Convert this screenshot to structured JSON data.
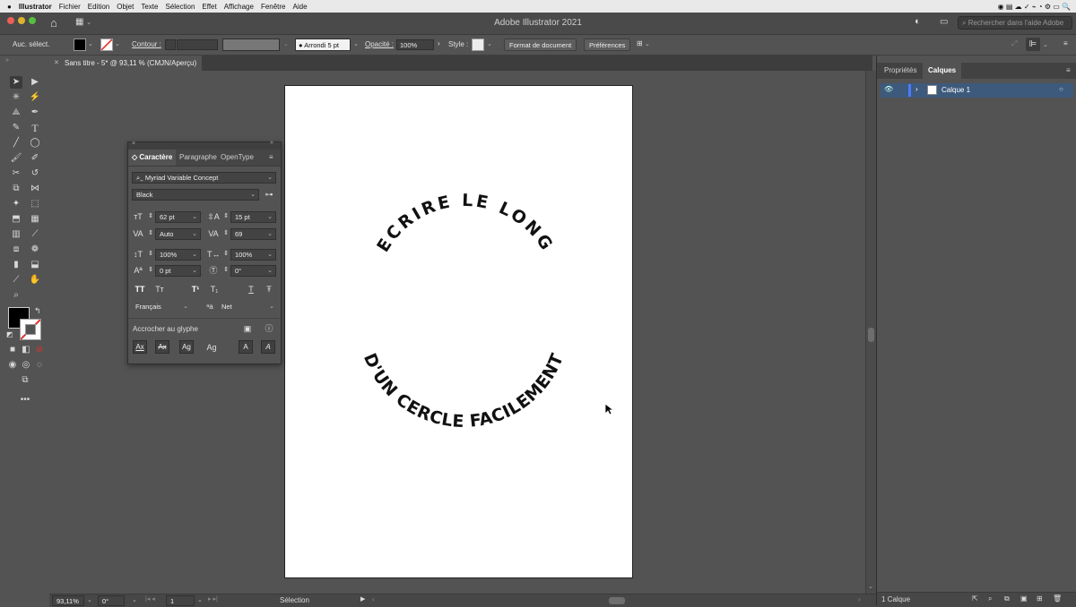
{
  "menubar": {
    "apple": "",
    "app": "Illustrator",
    "items": [
      "Fichier",
      "Edition",
      "Objet",
      "Texte",
      "Sélection",
      "Effet",
      "Affichage",
      "Fenêtre",
      "Aide"
    ]
  },
  "window": {
    "title": "Adobe Illustrator 2021",
    "help_search_placeholder": "Rechercher dans l'aide Adobe"
  },
  "control_bar": {
    "selection_label": "Auc. sélect.",
    "stroke_label": "Contour :",
    "brush_label": "Arrondi 5 pt",
    "opacity_label": "Opacité :",
    "opacity_value": "100%",
    "style_label": "Style :",
    "doc_format_button": "Format de document",
    "preferences_button": "Préférences"
  },
  "document_tab": {
    "title": "Sans titre - 5* @ 93,11 % (CMJN/Aperçu)",
    "close": "✕"
  },
  "artwork": {
    "arc_top": "ECRIRE LE LONG",
    "arc_bottom": "D'UN CERCLE FACILEMENT"
  },
  "character_panel": {
    "tabs": [
      "Caractère",
      "Paragraphe",
      "OpenType"
    ],
    "font_family": "Myriad Variable Concept",
    "font_style": "Black",
    "font_size": "62 pt",
    "leading": "15 pt",
    "kerning": "Auto",
    "tracking": "69",
    "vertical_scale": "100%",
    "horizontal_scale": "100%",
    "baseline_shift": "0 pt",
    "rotation": "0°",
    "language": "Français",
    "antialiasing": "Net",
    "snap_label": "Accrocher au glyphe",
    "style_buttons": [
      "TT",
      "Tт",
      "T¹",
      "T₁",
      "T",
      "Ŧ"
    ],
    "snap_buttons": [
      "Ax",
      "Ax",
      "Ag",
      "Ag",
      "A",
      "A"
    ]
  },
  "right_panel": {
    "tabs": [
      "Propriétés",
      "Calques"
    ],
    "layer_name": "Calque 1",
    "footer": "1 Calque"
  },
  "status_bar": {
    "zoom": "93,11%",
    "rotation": "0°",
    "artboard_number": "1",
    "tool_name": "Sélection"
  }
}
